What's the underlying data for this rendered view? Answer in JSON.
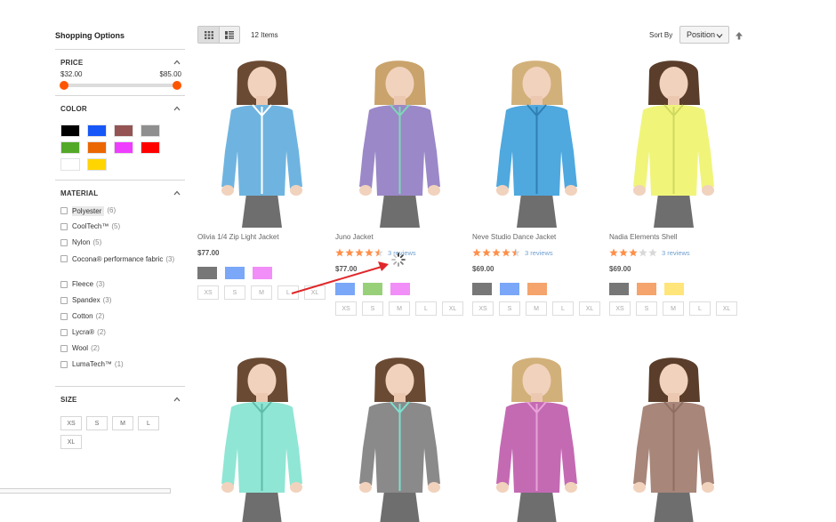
{
  "sidebar": {
    "title": "Shopping Options",
    "price": {
      "label": "PRICE",
      "min": "$32.00",
      "max": "$85.00"
    },
    "color": {
      "label": "COLOR",
      "swatches": [
        "#000000",
        "#1857f7",
        "#945454",
        "#8f8f8f",
        "#53a828",
        "#eb6703",
        "#ef3dff",
        "#ff0000",
        "#ffffff",
        "#ffd500"
      ]
    },
    "material": {
      "label": "MATERIAL",
      "items": [
        {
          "name": "Polyester",
          "count": "(6)"
        },
        {
          "name": "CoolTech™",
          "count": "(5)"
        },
        {
          "name": "Nylon",
          "count": "(5)"
        },
        {
          "name": "Cocona® performance fabric",
          "count": "(3)"
        },
        {
          "name": "Fleece",
          "count": "(3)"
        },
        {
          "name": "Spandex",
          "count": "(3)"
        },
        {
          "name": "Cotton",
          "count": "(2)"
        },
        {
          "name": "Lycra®",
          "count": "(2)"
        },
        {
          "name": "Wool",
          "count": "(2)"
        },
        {
          "name": "LumaTech™",
          "count": "(1)"
        }
      ]
    },
    "size": {
      "label": "SIZE",
      "options": [
        "XS",
        "S",
        "M",
        "L",
        "XL"
      ]
    }
  },
  "toolbar": {
    "item_count": "12 Items",
    "sort_label": "Sort By",
    "sort_value": "Position"
  },
  "products": [
    {
      "name": "Olivia 1/4 Zip Light Jacket",
      "price": "$77.00",
      "rating": null,
      "reviews": "",
      "colors": [
        "#777777",
        "#7aa7f7",
        "#f28ef7"
      ],
      "sizes": [
        "XS",
        "S",
        "M",
        "L",
        "XL"
      ],
      "garment": "#6fb4e0",
      "trim": "#ffffff",
      "hair": "#6b4a33"
    },
    {
      "name": "Juno Jacket",
      "price": "$77.00",
      "rating": 4.5,
      "reviews": "3 reviews",
      "colors": [
        "#7aa7f7",
        "#98d07a",
        "#f28ef7"
      ],
      "sizes": [
        "XS",
        "S",
        "M",
        "L",
        "XL"
      ],
      "garment": "#9b88c8",
      "trim": "#7fd7b8",
      "hair": "#c9a36b"
    },
    {
      "name": "Neve Studio Dance Jacket",
      "price": "$69.00",
      "rating": 4.5,
      "reviews": "3 reviews",
      "colors": [
        "#777777",
        "#7aa7f7",
        "#f4a46c"
      ],
      "sizes": [
        "XS",
        "S",
        "M",
        "L",
        "XL"
      ],
      "garment": "#4fa8de",
      "trim": "#2f7fb3",
      "hair": "#d2b07a"
    },
    {
      "name": "Nadia Elements Shell",
      "price": "$69.00",
      "rating": 3,
      "reviews": "3 reviews",
      "colors": [
        "#777777",
        "#f4a46c",
        "#ffe57a"
      ],
      "sizes": [
        "XS",
        "S",
        "M",
        "L",
        "XL"
      ],
      "garment": "#f0f57a",
      "trim": "#cfd860",
      "hair": "#5a3d2a"
    },
    {
      "name": "",
      "garment": "#8fe6d4",
      "trim": "#5fbca8",
      "hair": "#6b4a33"
    },
    {
      "name": "",
      "garment": "#8a8a8a",
      "trim": "#7de0cf",
      "hair": "#6b4a33"
    },
    {
      "name": "",
      "garment": "#c46ab3",
      "trim": "#e8a3d8",
      "hair": "#d2b07a"
    },
    {
      "name": "",
      "garment": "#a8867a",
      "trim": "#8f6e62",
      "hair": "#5a3d2a"
    }
  ],
  "icons": {
    "grid": "grid-icon",
    "list": "list-icon",
    "sort_direction": "arrow-up-icon",
    "loading": "spinner-icon"
  },
  "colors": {
    "accent": "#ff5501",
    "star": "#ff8f4a",
    "link": "#6f9fd0",
    "annotation": "#e0282a"
  }
}
